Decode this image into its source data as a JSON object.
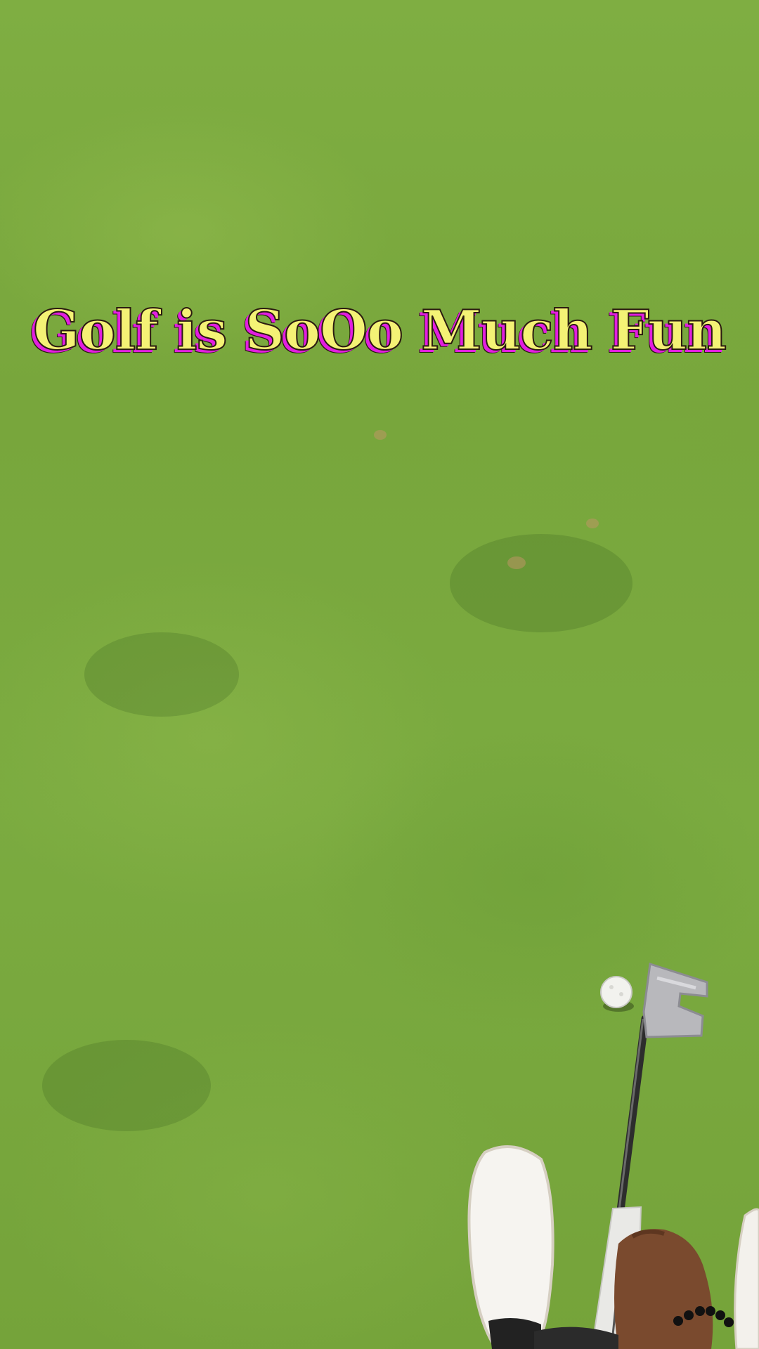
{
  "overlay": {
    "caption": "Golf is SoOo Much Fun",
    "caption_color": "#f4f275",
    "caption_shadow_color": "#e21ee0"
  },
  "scene": {
    "grass_color": "#7aa83c"
  }
}
